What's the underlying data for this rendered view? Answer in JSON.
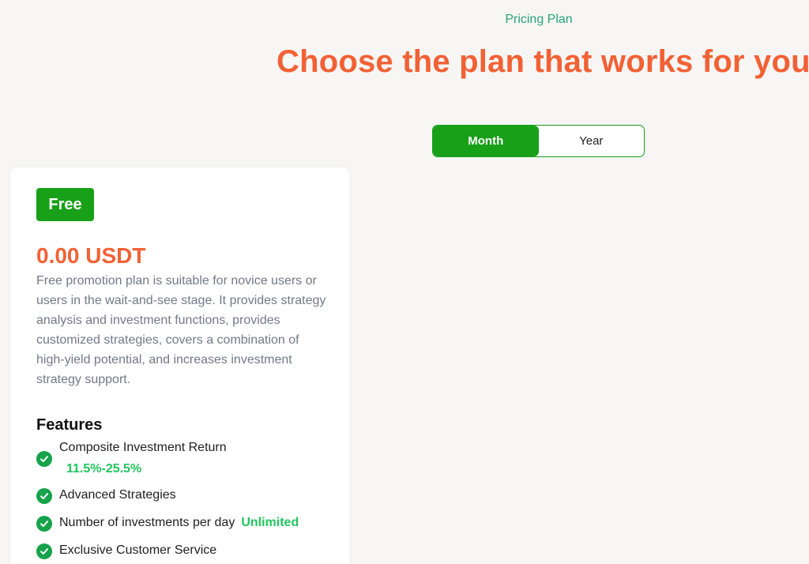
{
  "header": {
    "eyebrow": "Pricing Plan",
    "headline": "Choose the plan that works for you"
  },
  "billing_toggle": {
    "options": [
      "Month",
      "Year"
    ],
    "selected": "Month"
  },
  "plan": {
    "badge": "Free",
    "price": "0.00 USDT",
    "description": "Free promotion plan is suitable for novice users or users in the wait-and-see stage. It provides strategy analysis and investment functions, provides customized strategies, covers a combination of high-yield potential, and increases investment strategy support.",
    "features_title": "Features",
    "features": [
      {
        "label": "Composite Investment Return",
        "value": "11.5%-25.5%"
      },
      {
        "label": "Advanced Strategies",
        "value": ""
      },
      {
        "label": "Number of investments per day",
        "value": "Unlimited"
      },
      {
        "label": "Exclusive Customer Service",
        "value": ""
      }
    ]
  },
  "colors": {
    "accent_green": "#18a019",
    "accent_orange": "#f26135",
    "highlight_green": "#22c55e",
    "eyebrow_teal": "#2aa37a"
  },
  "icons": {
    "feature_check": "check-circle-icon"
  }
}
